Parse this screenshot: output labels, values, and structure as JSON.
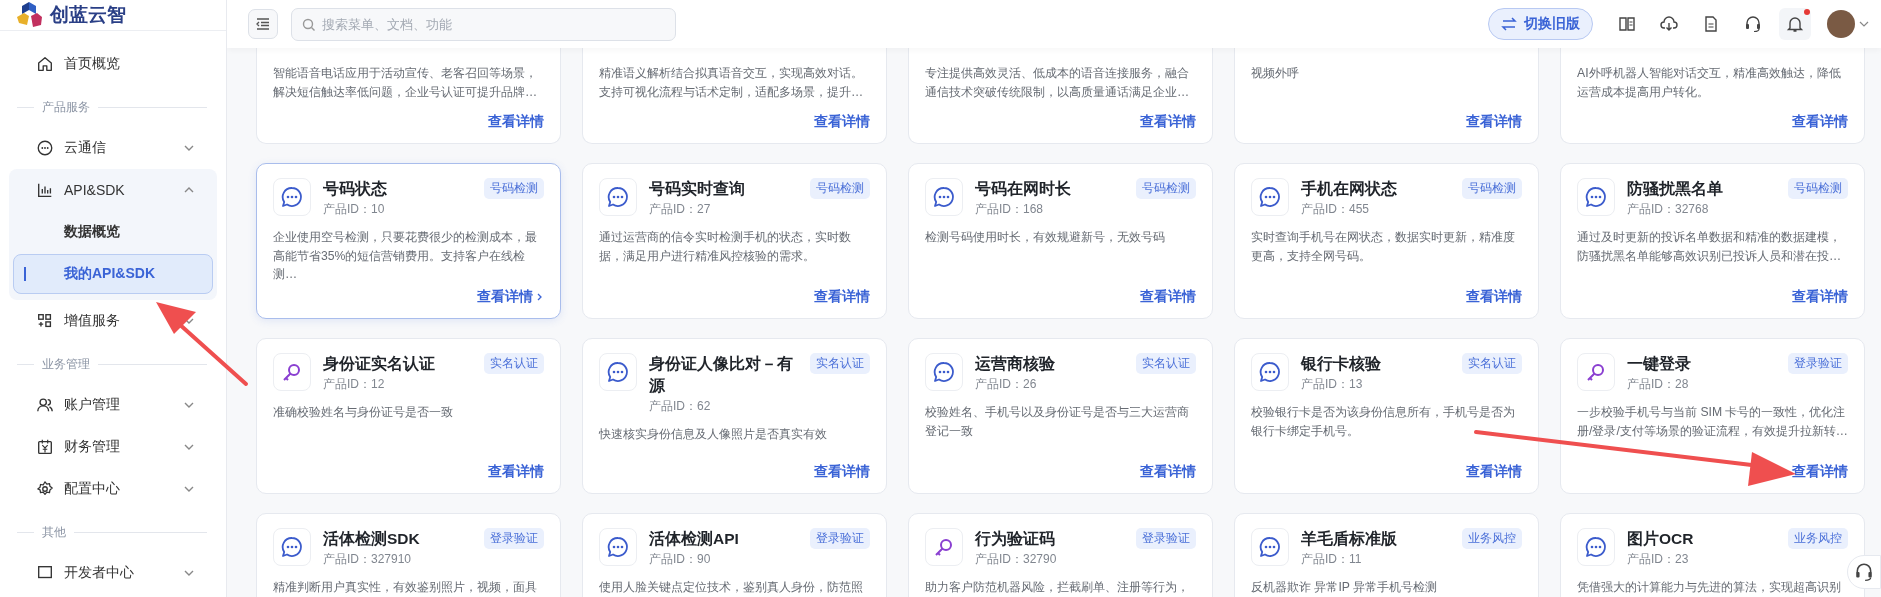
{
  "sidebar": {
    "logo": "创蓝云智",
    "items": [
      {
        "kind": "item",
        "label": "首页概览"
      },
      {
        "kind": "section",
        "label": "产品服务"
      },
      {
        "kind": "item",
        "label": "云通信",
        "expanded": false
      },
      {
        "kind": "group",
        "label": "API&SDK",
        "expanded": true,
        "children": [
          {
            "label": "数据概览",
            "selected": false
          },
          {
            "label": "我的API&SDK",
            "selected": true
          }
        ]
      },
      {
        "kind": "item",
        "label": "增值服务",
        "expanded": false
      },
      {
        "kind": "section",
        "label": "业务管理"
      },
      {
        "kind": "item",
        "label": "账户管理",
        "expanded": false
      },
      {
        "kind": "item",
        "label": "财务管理",
        "expanded": false
      },
      {
        "kind": "item",
        "label": "配置中心",
        "expanded": false
      },
      {
        "kind": "section",
        "label": "其他"
      },
      {
        "kind": "item",
        "label": "开发者中心",
        "expanded": false
      }
    ]
  },
  "topbar": {
    "search": {
      "placeholder": "搜索菜单、文档、功能"
    },
    "switch_button": "切换旧版",
    "notifications_unread": true
  },
  "cards": [
    {
      "desc": "智能语音电话应用于活动宣传、老客召回等场景，解决短信触达率低问题，企业号认证可提升品牌…",
      "link": "查看详情",
      "selected": false
    },
    {
      "desc": "精准语义解析结合拟真语音交互，实现高效对话。支持可视化流程与话术定制，适配多场景，提升…",
      "link": "查看详情",
      "selected": false
    },
    {
      "desc": "专注提供高效灵活、低成本的语音连接服务，融合通信技术突破传统限制，以高质量通话满足企业…",
      "link": "查看详情",
      "selected": false
    },
    {
      "desc": "视频外呼",
      "link": "查看详情",
      "selected": false
    },
    {
      "desc": "AI外呼机器人智能对话交互，精准高效触达，降低运营成本提高用户转化。",
      "link": "查看详情",
      "selected": false
    },
    {
      "kind": "chat",
      "title": "号码状态",
      "product_id": "产品ID：10",
      "tag": "号码检测",
      "desc": "企业使用空号检测，只要花费很少的检测成本，最高能节省35%的短信营销费用。支持客户在线检测…",
      "link": "查看详情",
      "selected": true
    },
    {
      "kind": "chat",
      "title": "号码实时查询",
      "product_id": "产品ID：27",
      "tag": "号码检测",
      "desc": "通过运营商的信令实时检测手机的状态，实时数据，满足用户进行精准风控核验的需求。",
      "link": "查看详情",
      "selected": false
    },
    {
      "kind": "chat",
      "title": "号码在网时长",
      "product_id": "产品ID：168",
      "tag": "号码检测",
      "desc": "检测号码使用时长，有效规避新号，无效号码",
      "link": "查看详情",
      "selected": false
    },
    {
      "kind": "chat",
      "title": "手机在网状态",
      "product_id": "产品ID：455",
      "tag": "号码检测",
      "desc": "实时查询手机号在网状态，数据实时更新，精准度更高，支持全网号码。",
      "link": "查看详情",
      "selected": false
    },
    {
      "kind": "chat",
      "title": "防骚扰黑名单",
      "product_id": "产品ID：32768",
      "tag": "号码检测",
      "desc": "通过及时更新的投诉名单数据和精准的数据建模，防骚扰黑名单能够高效识别已投诉人员和潜在投…",
      "link": "查看详情",
      "selected": false
    },
    {
      "kind": "key",
      "title": "身份证实名认证",
      "product_id": "产品ID：12",
      "tag": "实名认证",
      "desc": "准确校验姓名与身份证号是否一致",
      "link": "查看详情",
      "selected": false
    },
    {
      "kind": "chat",
      "title": "身份证人像比对－有源",
      "product_id": "产品ID：62",
      "tag": "实名认证",
      "desc": "快速核实身份信息及人像照片是否真实有效",
      "link": "查看详情",
      "selected": false
    },
    {
      "kind": "chat",
      "title": "运营商核验",
      "product_id": "产品ID：26",
      "tag": "实名认证",
      "desc": "校验姓名、手机号以及身份证号是否与三大运营商登记一致",
      "link": "查看详情",
      "selected": false
    },
    {
      "kind": "chat",
      "title": "银行卡核验",
      "product_id": "产品ID：13",
      "tag": "实名认证",
      "desc": "校验银行卡是否为该身份信息所有，手机号是否为银行卡绑定手机号。",
      "link": "查看详情",
      "selected": false
    },
    {
      "kind": "key",
      "title": "一键登录",
      "product_id": "产品ID：28",
      "tag": "登录验证",
      "desc": "一步校验手机号与当前 SIM 卡号的一致性，优化注册/登录/支付等场景的验证流程，有效提升拉新转…",
      "link": "查看详情",
      "selected": false
    },
    {
      "kind": "chat",
      "title": "活体检测SDK",
      "product_id": "产品ID：327910",
      "tag": "登录验证",
      "desc": "精准判断用户真实性，有效鉴别照片，视频，面具"
    },
    {
      "kind": "chat",
      "title": "活体检测API",
      "product_id": "产品ID：90",
      "tag": "登录验证",
      "desc": "使用人脸关键点定位技术，鉴别真人身份，防范照"
    },
    {
      "kind": "key",
      "title": "行为验证码",
      "product_id": "产品ID：32790",
      "tag": "登录验证",
      "desc": "助力客户防范机器风险，拦截刷单、注册等行为，"
    },
    {
      "kind": "chat",
      "title": "羊毛盾标准版",
      "product_id": "产品ID：11",
      "tag": "业务风控",
      "desc": "反机器欺诈 异常IP 异常手机号检测"
    },
    {
      "kind": "chat",
      "title": "图片OCR",
      "product_id": "产品ID：23",
      "tag": "业务风控",
      "desc": "凭借强大的计算能力与先进的算法，实现超高识别"
    }
  ]
}
